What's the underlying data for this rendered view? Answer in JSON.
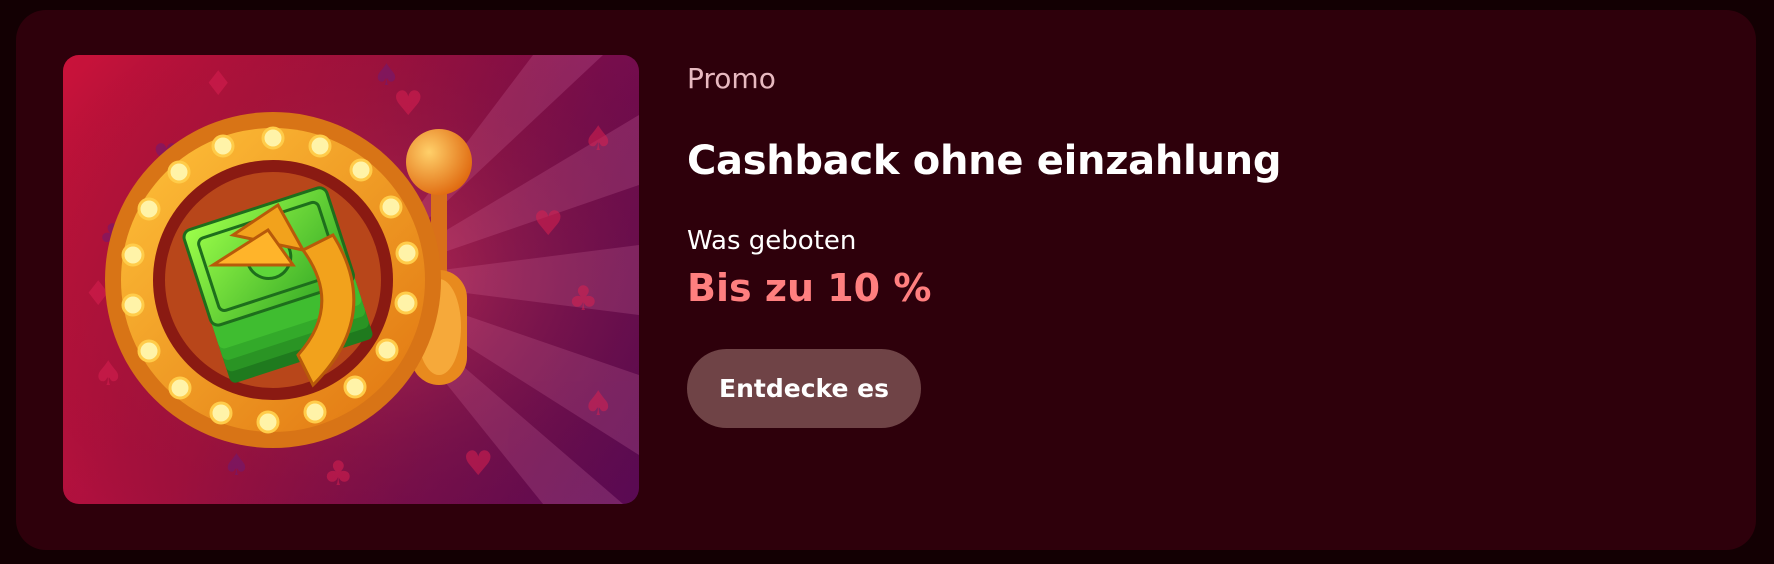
{
  "promo": {
    "eyebrow": "Promo",
    "title": "Cashback ohne einzahlung",
    "offer_label": "Was geboten",
    "offer_value": "Bis zu 10 %",
    "cta_label": "Entdecke es"
  },
  "image": {
    "icon": "slot-machine-cashback-icon"
  },
  "colors": {
    "page_background": "#130003",
    "card_background": "#2e000b",
    "eyebrow": "#e7b9c0",
    "title": "#ffffff",
    "offer_value": "#ff7f7f",
    "cta_background": "#6f4346"
  }
}
